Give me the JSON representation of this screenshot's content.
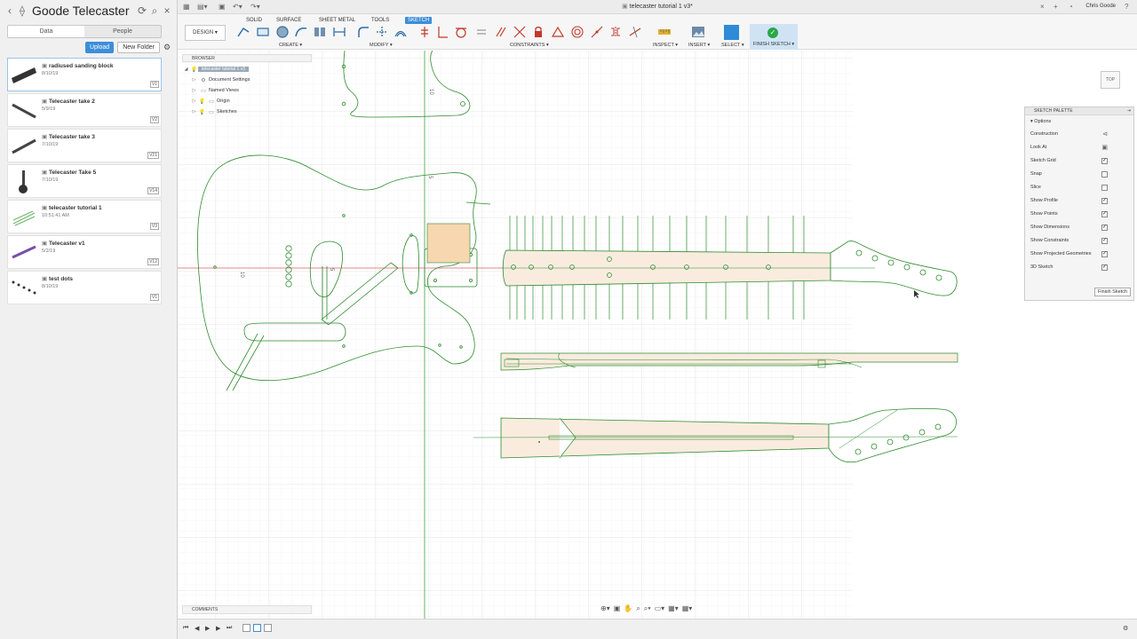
{
  "data_panel": {
    "title": "Goode Telecaster",
    "tabs": [
      "Data",
      "People"
    ],
    "upload_label": "Upload",
    "new_folder_label": "New Folder",
    "files": [
      {
        "name": "radiused sanding block",
        "date": "8/10/19",
        "version": "V1"
      },
      {
        "name": "Telecaster take 2",
        "date": "5/9/19",
        "version": "V2"
      },
      {
        "name": "Telecaster take 3",
        "date": "7/10/19",
        "version": "V21"
      },
      {
        "name": "Telecaster Take 5",
        "date": "7/10/19",
        "version": "V14"
      },
      {
        "name": "telecaster tutorial 1",
        "date": "10:51:41 AM",
        "version": "V3"
      },
      {
        "name": "Telecaster v1",
        "date": "5/2/19",
        "version": "V12"
      },
      {
        "name": "test dots",
        "date": "8/10/19",
        "version": "V1"
      }
    ]
  },
  "topbar": {
    "doc_title": "telecaster tutorial 1 v3*",
    "user": "Chris Goode"
  },
  "toolbar": {
    "workspace_tabs": [
      "SOLID",
      "SURFACE",
      "SHEET METAL",
      "TOOLS",
      "SKETCH"
    ],
    "active_tab": "SKETCH",
    "design_label": "DESIGN ▾",
    "groups": {
      "create": "CREATE ▾",
      "modify": "MODIFY ▾",
      "constraints": "CONSTRAINTS ▾",
      "inspect": "INSPECT ▾",
      "insert": "INSERT ▾",
      "select": "SELECT ▾",
      "finish": "FINISH SKETCH ▾"
    }
  },
  "browser": {
    "title": "BROWSER",
    "root": "telecaster tutorial 1 v3",
    "items": [
      "Document Settings",
      "Named Views",
      "Origin",
      "Sketches"
    ]
  },
  "viewcube": {
    "face": "TOP"
  },
  "palette": {
    "title": "SKETCH PALETTE",
    "options_label": "Options",
    "rows": [
      {
        "label": "Construction",
        "kind": "icon",
        "icon": "construction-line-icon"
      },
      {
        "label": "Look At",
        "kind": "icon",
        "icon": "look-at-icon"
      },
      {
        "label": "Sketch Grid",
        "kind": "check",
        "checked": true
      },
      {
        "label": "Snap",
        "kind": "check",
        "checked": false
      },
      {
        "label": "Slice",
        "kind": "check",
        "checked": false
      },
      {
        "label": "Show Profile",
        "kind": "check",
        "checked": true
      },
      {
        "label": "Show Points",
        "kind": "check",
        "checked": true
      },
      {
        "label": "Show Dimensions",
        "kind": "check",
        "checked": true
      },
      {
        "label": "Show Constraints",
        "kind": "check",
        "checked": true
      },
      {
        "label": "Show Projected Geometries",
        "kind": "check",
        "checked": true
      },
      {
        "label": "3D Sketch",
        "kind": "check",
        "checked": true
      }
    ],
    "finish_label": "Finish Sketch"
  },
  "comments": {
    "title": "COMMENTS"
  },
  "sketch": {
    "dimension_labels": [
      "10",
      "5",
      "10",
      "5"
    ],
    "line_color": "#2e8b2e",
    "profile_fill": "#f9ecdf",
    "pickguard_fill": "#f7d7b0"
  }
}
